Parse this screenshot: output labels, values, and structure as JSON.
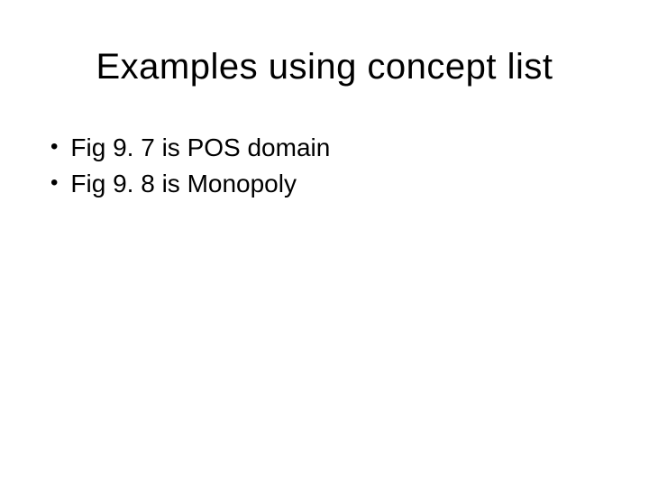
{
  "slide": {
    "title": "Examples using concept list",
    "bullets": [
      {
        "text": "Fig 9. 7 is POS domain"
      },
      {
        "text": "Fig 9. 8 is Monopoly"
      }
    ]
  }
}
